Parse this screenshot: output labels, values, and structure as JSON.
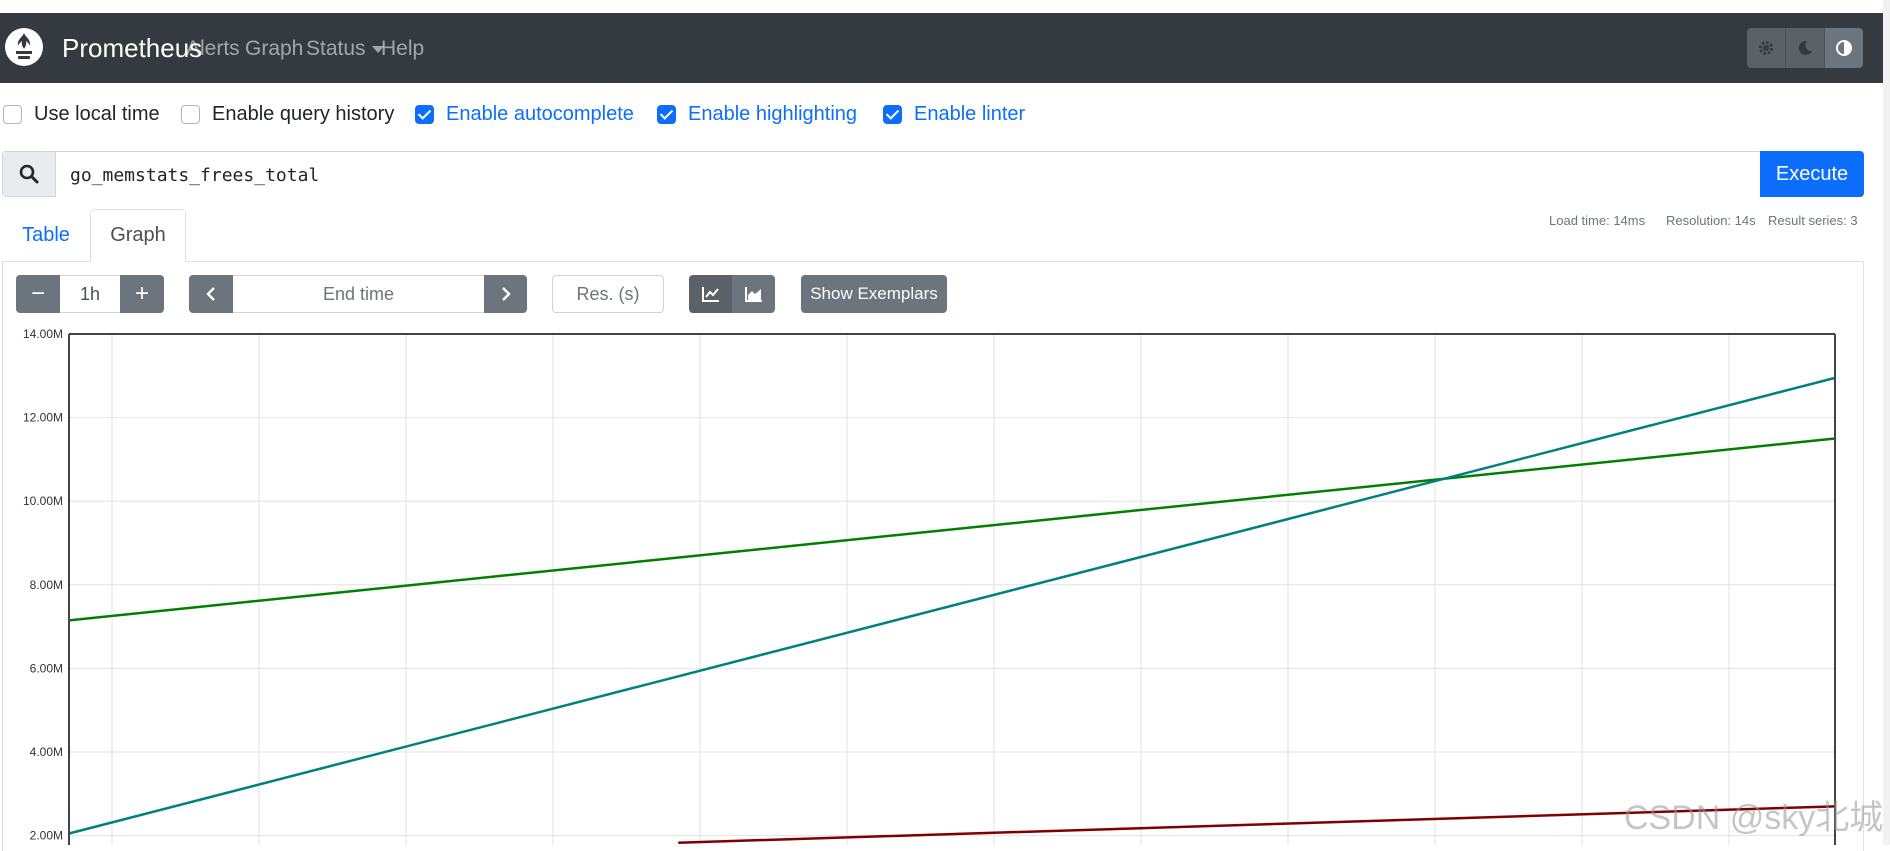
{
  "navbar": {
    "brand": "Prometheus",
    "links": [
      "Alerts",
      "Graph",
      "Status",
      "Help"
    ],
    "theme_buttons": [
      "gear-icon",
      "moon-icon",
      "contrast-icon"
    ]
  },
  "options": [
    {
      "label": "Use local time",
      "checked": false
    },
    {
      "label": "Enable query history",
      "checked": false
    },
    {
      "label": "Enable autocomplete",
      "checked": true
    },
    {
      "label": "Enable highlighting",
      "checked": true
    },
    {
      "label": "Enable linter",
      "checked": true
    }
  ],
  "query": {
    "value": "go_memstats_frees_total",
    "execute_label": "Execute"
  },
  "tabs": {
    "table": "Table",
    "graph": "Graph"
  },
  "stats": {
    "load_time": "Load time: 14ms",
    "resolution": "Resolution: 14s",
    "result_series": "Result series: 3"
  },
  "controls": {
    "minus": "−",
    "range": "1h",
    "plus": "+",
    "end_time_placeholder": "End time",
    "resolution_placeholder": "Res. (s)",
    "show_exemplars": "Show Exemplars"
  },
  "chart_data": {
    "type": "line",
    "y_ticks": [
      "14.00M",
      "12.00M",
      "10.00M",
      "8.00M",
      "6.00M",
      "4.00M",
      "2.00M"
    ],
    "ylim": [
      1.8,
      14.0
    ],
    "y_unit": "M",
    "x": [
      0,
      100
    ],
    "grid": true,
    "series": [
      {
        "color": "#008000",
        "values": [
          7.15,
          11.5
        ]
      },
      {
        "color": "#008080",
        "values": [
          2.05,
          12.95
        ]
      },
      {
        "color": "#800000",
        "start_x": 34.5,
        "values": [
          1.83,
          2.7
        ]
      }
    ]
  },
  "watermark": "CSDN @sky北城"
}
